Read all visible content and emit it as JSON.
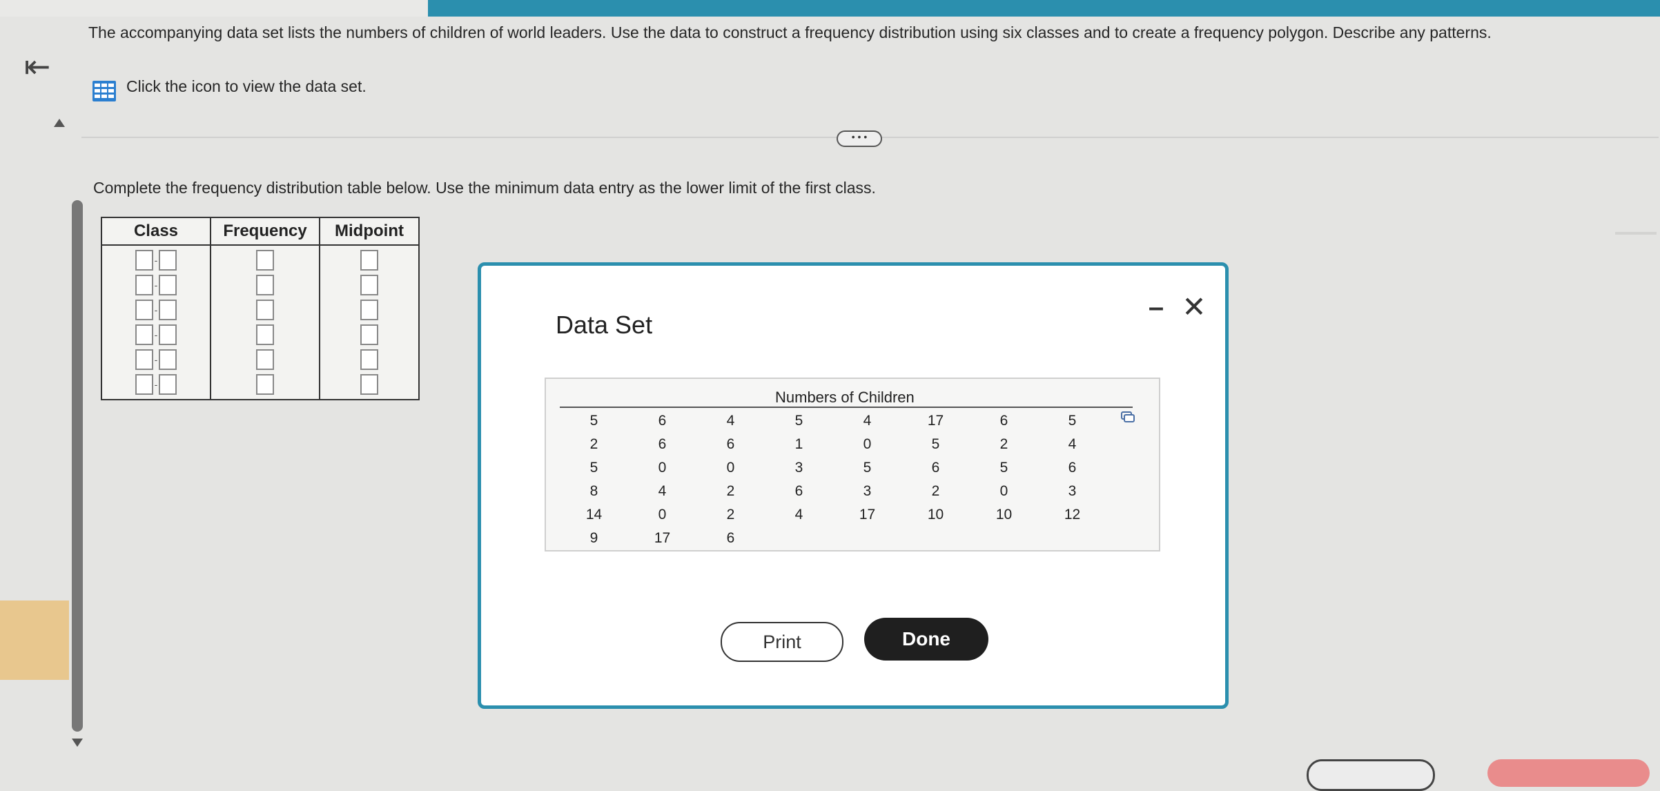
{
  "question": {
    "text": "The accompanying data set lists the numbers of children of world leaders. Use the data to construct a frequency distribution using six classes and to create a frequency polygon. Describe any patterns.",
    "dataset_link": "Click the icon to view the data set."
  },
  "more_button": "• • •",
  "instruction": "Complete the frequency distribution table below. Use the minimum data entry as the lower limit of the first class.",
  "table": {
    "headers": [
      "Class",
      "Frequency",
      "Midpoint"
    ],
    "rows": 6
  },
  "modal": {
    "title": "Data Set",
    "minimize": "–",
    "close": "✕",
    "heading": "Numbers of Children",
    "rows": [
      [
        "5",
        "6",
        "4",
        "5",
        "4",
        "17",
        "6",
        "5"
      ],
      [
        "2",
        "6",
        "6",
        "1",
        "0",
        "5",
        "2",
        "4"
      ],
      [
        "5",
        "0",
        "0",
        "3",
        "5",
        "6",
        "5",
        "6"
      ],
      [
        "8",
        "4",
        "2",
        "6",
        "3",
        "2",
        "0",
        "3"
      ],
      [
        "14",
        "0",
        "2",
        "4",
        "17",
        "10",
        "10",
        "12"
      ],
      [
        "9",
        "17",
        "6",
        "",
        "",
        "",
        "",
        ""
      ]
    ],
    "print_label": "Print",
    "done_label": "Done"
  },
  "icons": {
    "back": "back-arrow-icon",
    "dataset": "grid-table-icon",
    "copy": "copy-icon"
  },
  "colors": {
    "accent": "#2b8fae",
    "done_button": "#1f1f1f"
  }
}
